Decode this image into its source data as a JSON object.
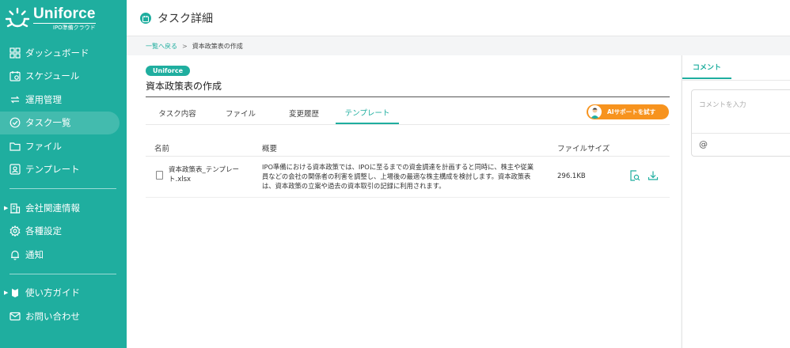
{
  "brand": {
    "name": "Uniforce",
    "tagline": "IPO準備クラウド",
    "accent": "#1fae9f",
    "ai_color": "#f7931e"
  },
  "sidebar": {
    "group1": [
      {
        "label": "ダッシュボード",
        "icon": "grid-icon"
      },
      {
        "label": "スケジュール",
        "icon": "calendar-icon"
      },
      {
        "label": "運用管理",
        "icon": "refresh-icon"
      },
      {
        "label": "タスク一覧",
        "icon": "check-circle-icon",
        "active": true
      },
      {
        "label": "ファイル",
        "icon": "folder-icon"
      },
      {
        "label": "テンプレート",
        "icon": "template-icon"
      }
    ],
    "group2": [
      {
        "label": "会社関連情報",
        "icon": "building-icon",
        "expandable": true
      },
      {
        "label": "各種設定",
        "icon": "gear-icon"
      },
      {
        "label": "通知",
        "icon": "bell-icon"
      }
    ],
    "group3": [
      {
        "label": "使い方ガイド",
        "icon": "guide-icon",
        "expandable": true
      },
      {
        "label": "お問い合わせ",
        "icon": "mail-icon"
      }
    ]
  },
  "header": {
    "title": "タスク詳細"
  },
  "breadcrumb": {
    "back": "一覧へ戻る",
    "separator": ">",
    "current": "資本政策表の作成"
  },
  "task": {
    "badge": "Uniforce",
    "title": "資本政策表の作成",
    "tabs": [
      "タスク内容",
      "ファイル",
      "変更履歴",
      "テンプレート"
    ],
    "active_tab": "テンプレート",
    "ai_button": "AIサポートを試す"
  },
  "table": {
    "headers": {
      "name": "名前",
      "summary": "概要",
      "size": "ファイルサイズ"
    },
    "rows": [
      {
        "name": "資本政策表_テンプレート.xlsx",
        "summary": "IPO準備における資本政策では、IPOに至るまでの資金調達を計画すると同時に、株主や従業員などの会社の関係者の利害を調整し、上場後の最適な株主構成を検討します。資本政策表は、資本政策の立案や過去の資本取引の記録に利用されます。",
        "size": "296.1KB"
      }
    ]
  },
  "comments": {
    "tab": "コメント",
    "placeholder": "コメントを入力",
    "mention": "@"
  }
}
